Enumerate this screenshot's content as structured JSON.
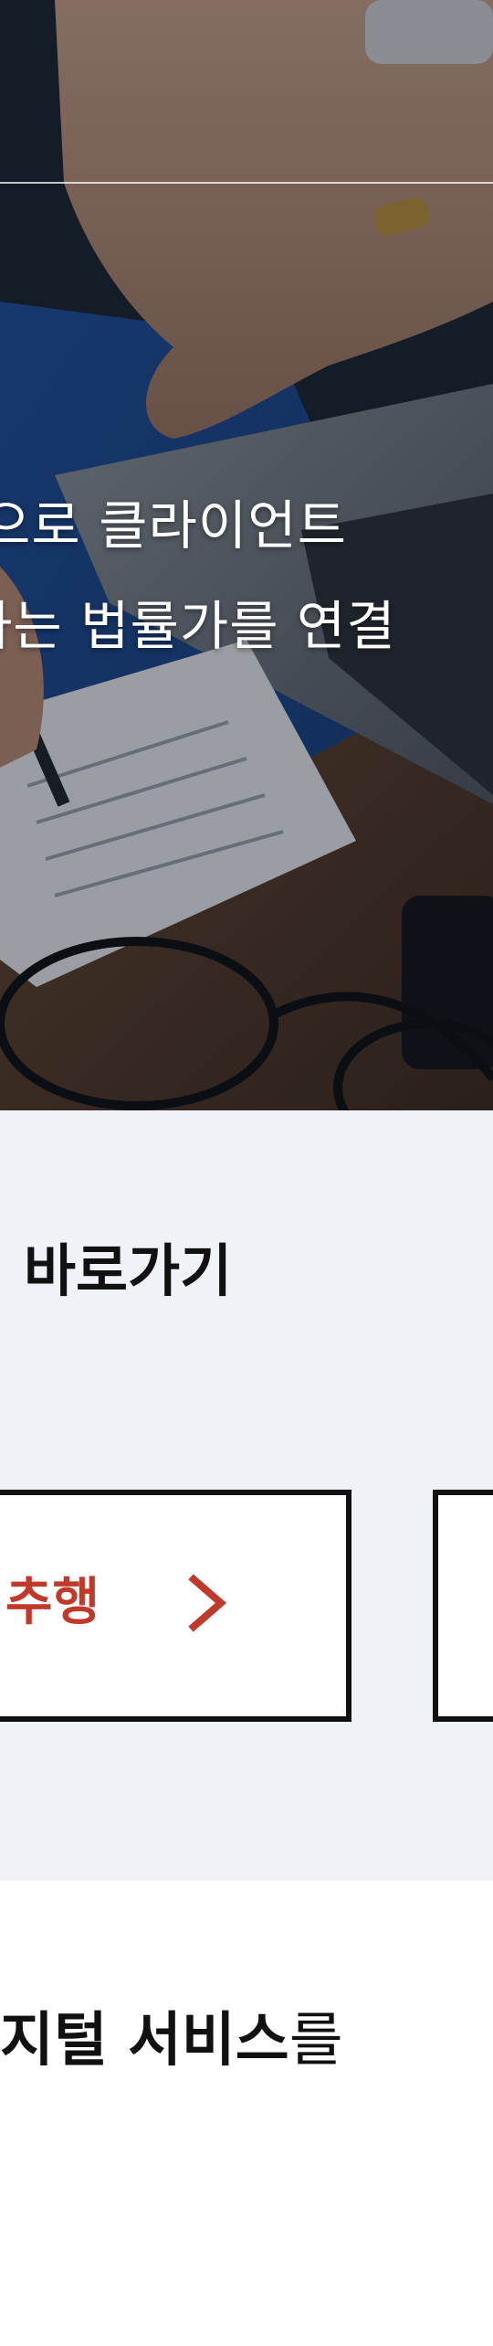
{
  "hero": {
    "line1": "으로 클라이언트",
    "line2": "하는 법률가를 연결"
  },
  "shortcuts": {
    "title": "바로가기",
    "card1_label": "추행",
    "card1_icon": "chevron-right-icon"
  },
  "digital": {
    "title_bold": "지털 서비스",
    "title_light": "를"
  },
  "colors": {
    "accent": "#c0392b",
    "shortcut_bg": "#eff3f7",
    "text": "#111111"
  }
}
